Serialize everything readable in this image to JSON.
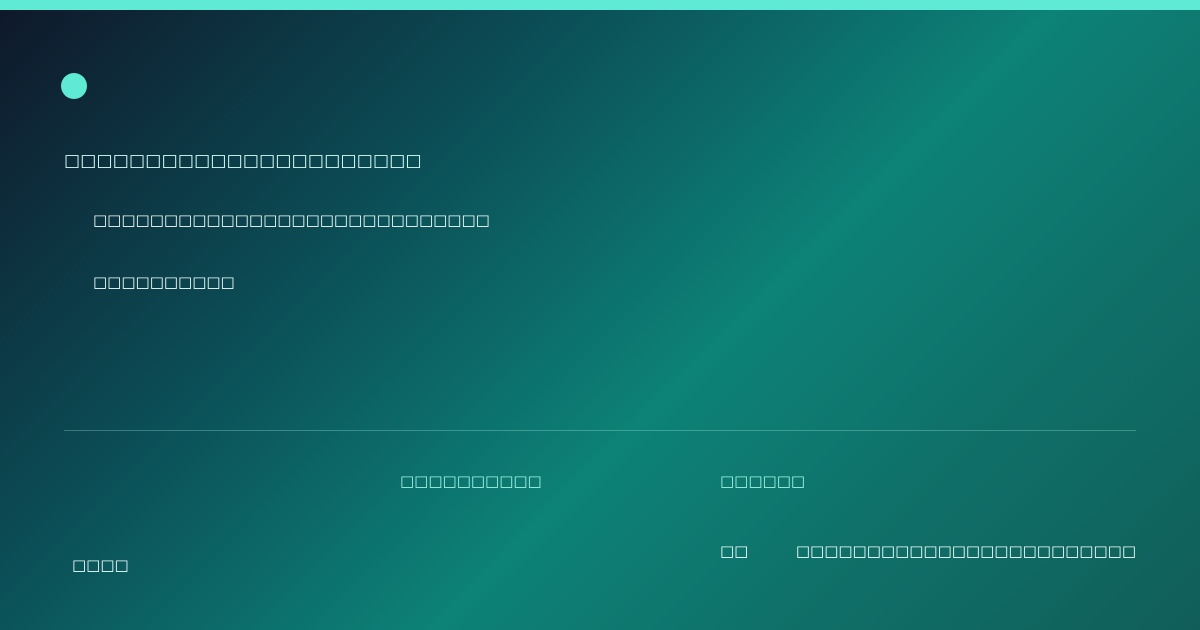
{
  "accent_color": "#5eead4",
  "background_colors": [
    "#0f172a",
    "#0b4f57",
    "#0d8277",
    "#115e59"
  ],
  "header": {
    "title": "□□□□□□□□□□□□□□□□□□□□□□"
  },
  "content": {
    "line_1": "□□□□□□□□□□□□□□□□□□□□□□□□□□□□",
    "line_2": "□□□□□□□□□□"
  },
  "footer": {
    "label_1": "□□□□□□□□□□",
    "label_2": "□□□□□□",
    "left_value": "□□□□",
    "mid_value": "□□",
    "right_value": "□□□□□□□□□□□□□□□□□□□□□□□□"
  }
}
